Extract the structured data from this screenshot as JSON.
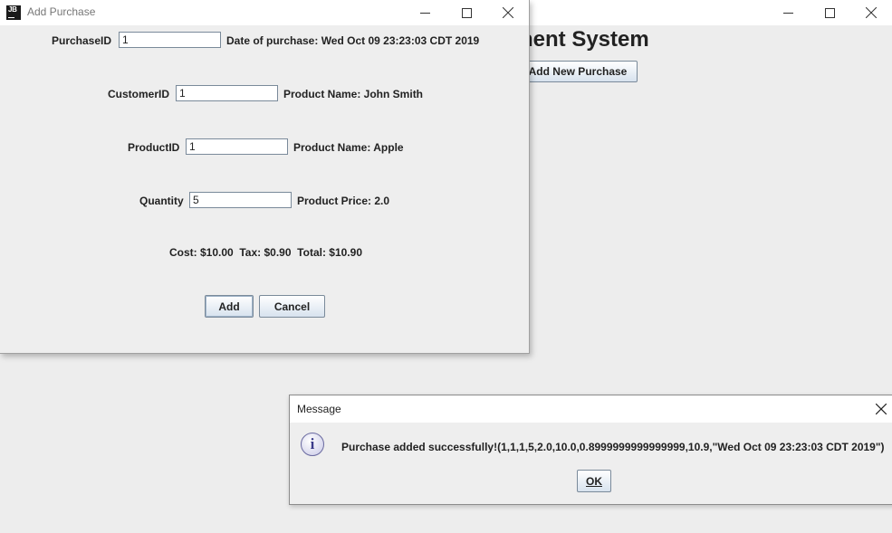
{
  "main_window": {
    "title_partial": "nent System",
    "add_new_purchase_label": "Add New Purchase"
  },
  "purchase_dialog": {
    "title": "Add Purchase",
    "app_icon_text": "JB",
    "purchase_id": {
      "label": "PurchaseID",
      "value": "1"
    },
    "date_of_purchase": "Date of purchase: Wed Oct 09 23:23:03 CDT 2019",
    "customer_id": {
      "label": "CustomerID",
      "value": "1"
    },
    "customer_name": "Product Name: John Smith",
    "product_id": {
      "label": "ProductID",
      "value": "1"
    },
    "product_name": "Product Name: Apple",
    "quantity": {
      "label": "Quantity",
      "value": "5"
    },
    "product_price": "Product Price: 2.0",
    "totals": "Cost: $10.00  Tax: $0.90  Total: $10.90",
    "add_label": "Add",
    "cancel_label": "Cancel"
  },
  "message_dialog": {
    "title": "Message",
    "icon": "info-icon",
    "icon_glyph": "i",
    "text": "Purchase added successfully!(1,1,1,5,2.0,10.0,0.8999999999999999,10.9,\"Wed Oct 09 23:23:03 CDT 2019\")",
    "ok_label": "OK"
  }
}
